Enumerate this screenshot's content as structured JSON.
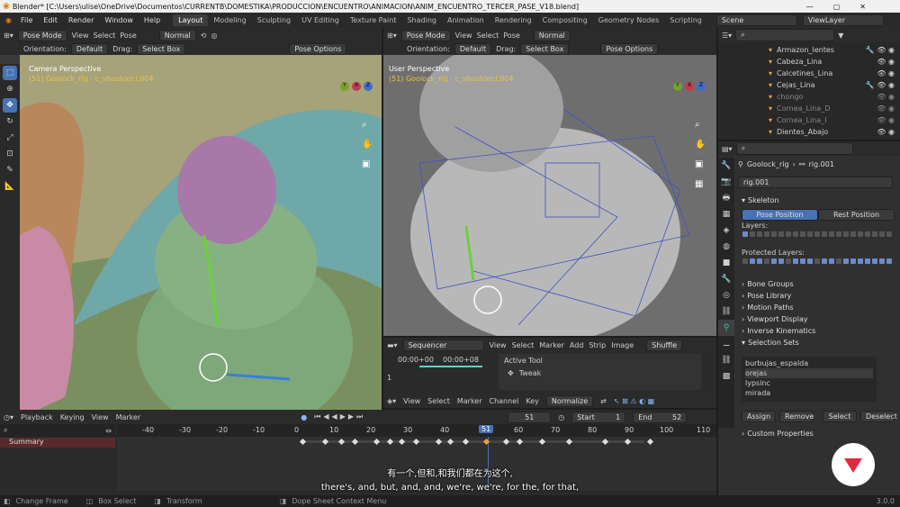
{
  "window": {
    "title": "Blender* [C:\\Users\\ulise\\OneDrive\\Documentos\\CURRENTB\\DOMESTIKA\\PRODUCCION\\ENCUENTRO\\ANIMACION\\ANIM_ENCUENTRO_TERCER_PASE_V18.blend]"
  },
  "menu": [
    "File",
    "Edit",
    "Render",
    "Window",
    "Help"
  ],
  "workspaces": [
    "Layout",
    "Modeling",
    "Sculpting",
    "UV Editing",
    "Texture Paint",
    "Shading",
    "Animation",
    "Rendering",
    "Compositing",
    "Geometry Nodes",
    "Scripting"
  ],
  "scene": "Scene",
  "view_layer": "ViewLayer",
  "viewport_left": {
    "mode": "Pose Mode",
    "menus": [
      "View",
      "Select",
      "Pose"
    ],
    "orientation_label": "Orientation:",
    "orientation": "Default",
    "drag_label": "Drag:",
    "drag": "Select Box",
    "pivot": "Normal",
    "options": "Pose Options",
    "title": "Camera Perspective",
    "subtitle": "(51) Goolock_rig : c_shoulder.l.004",
    "axes": [
      "Y",
      "X",
      "Z"
    ]
  },
  "viewport_right": {
    "mode": "Pose Mode",
    "menus": [
      "View",
      "Select",
      "Pose"
    ],
    "orientation_label": "Orientation:",
    "orientation": "Default",
    "drag_label": "Drag:",
    "drag": "Select Box",
    "pivot": "Normal",
    "options": "Pose Options",
    "title": "User Perspective",
    "subtitle": "(51) Goolock_rig : c_shoulder.l.004",
    "axes": [
      "Y",
      "X",
      "Z"
    ]
  },
  "outliner": [
    "Armazon_lentes",
    "Cabeza_Lina",
    "Calcetines_Lina",
    "Cejas_Lina",
    "chongo",
    "Cornea_Lina_D",
    "Cornea_Lina_I",
    "Dientes_Abajo"
  ],
  "properties": {
    "object": "Goolock_rig",
    "data": "rig.001",
    "data_field": "rig.001",
    "skeleton": "Skeleton",
    "pose_position": "Pose Position",
    "rest_position": "Rest Position",
    "layers": "Layers:",
    "protected_layers": "Protected Layers:",
    "panels": [
      "Bone Groups",
      "Pose Library",
      "Motion Paths",
      "Viewport Display",
      "Inverse Kinematics",
      "Selection Sets"
    ],
    "selection_sets": [
      "burbujas_espalda",
      "orejas",
      "lypsinc",
      "mirada"
    ],
    "set_buttons": [
      "Assign",
      "Remove",
      "Select",
      "Deselect"
    ],
    "custom": "Custom Properties"
  },
  "sequencer": {
    "name": "Sequencer",
    "menus": [
      "View",
      "Select",
      "Marker",
      "Add",
      "Strip",
      "Image"
    ],
    "shuffle": "Shuffle",
    "timecode_a": "00:00+00",
    "timecode_b": "00:00+08",
    "channel": "1",
    "active_tool": "Active Tool",
    "tweak": "Tweak"
  },
  "dopesheet_hdr": {
    "menus": [
      "View",
      "Select",
      "Marker",
      "Channel",
      "Key"
    ],
    "normalize": "Normalize"
  },
  "timeline": {
    "menus": [
      "Playback",
      "Keying",
      "View",
      "Marker"
    ],
    "frame": "51",
    "start_label": "Start",
    "start": "1",
    "end_label": "End",
    "end": "52",
    "ticks": [
      "-40",
      "-30",
      "-20",
      "-10",
      "0",
      "10",
      "20",
      "30",
      "40",
      "51",
      "60",
      "70",
      "80",
      "90",
      "100",
      "110"
    ],
    "current": "51",
    "summary": "Summary"
  },
  "subtitles": {
    "zh": "有一个,但和,和我们都在为这个,",
    "en": "there's, and, but, and, and, we're, we're, for the, for that,"
  },
  "status": [
    "Change Frame",
    "Box Select",
    "Transform",
    "Dope Sheet Context Menu"
  ],
  "version": "3.0.0"
}
